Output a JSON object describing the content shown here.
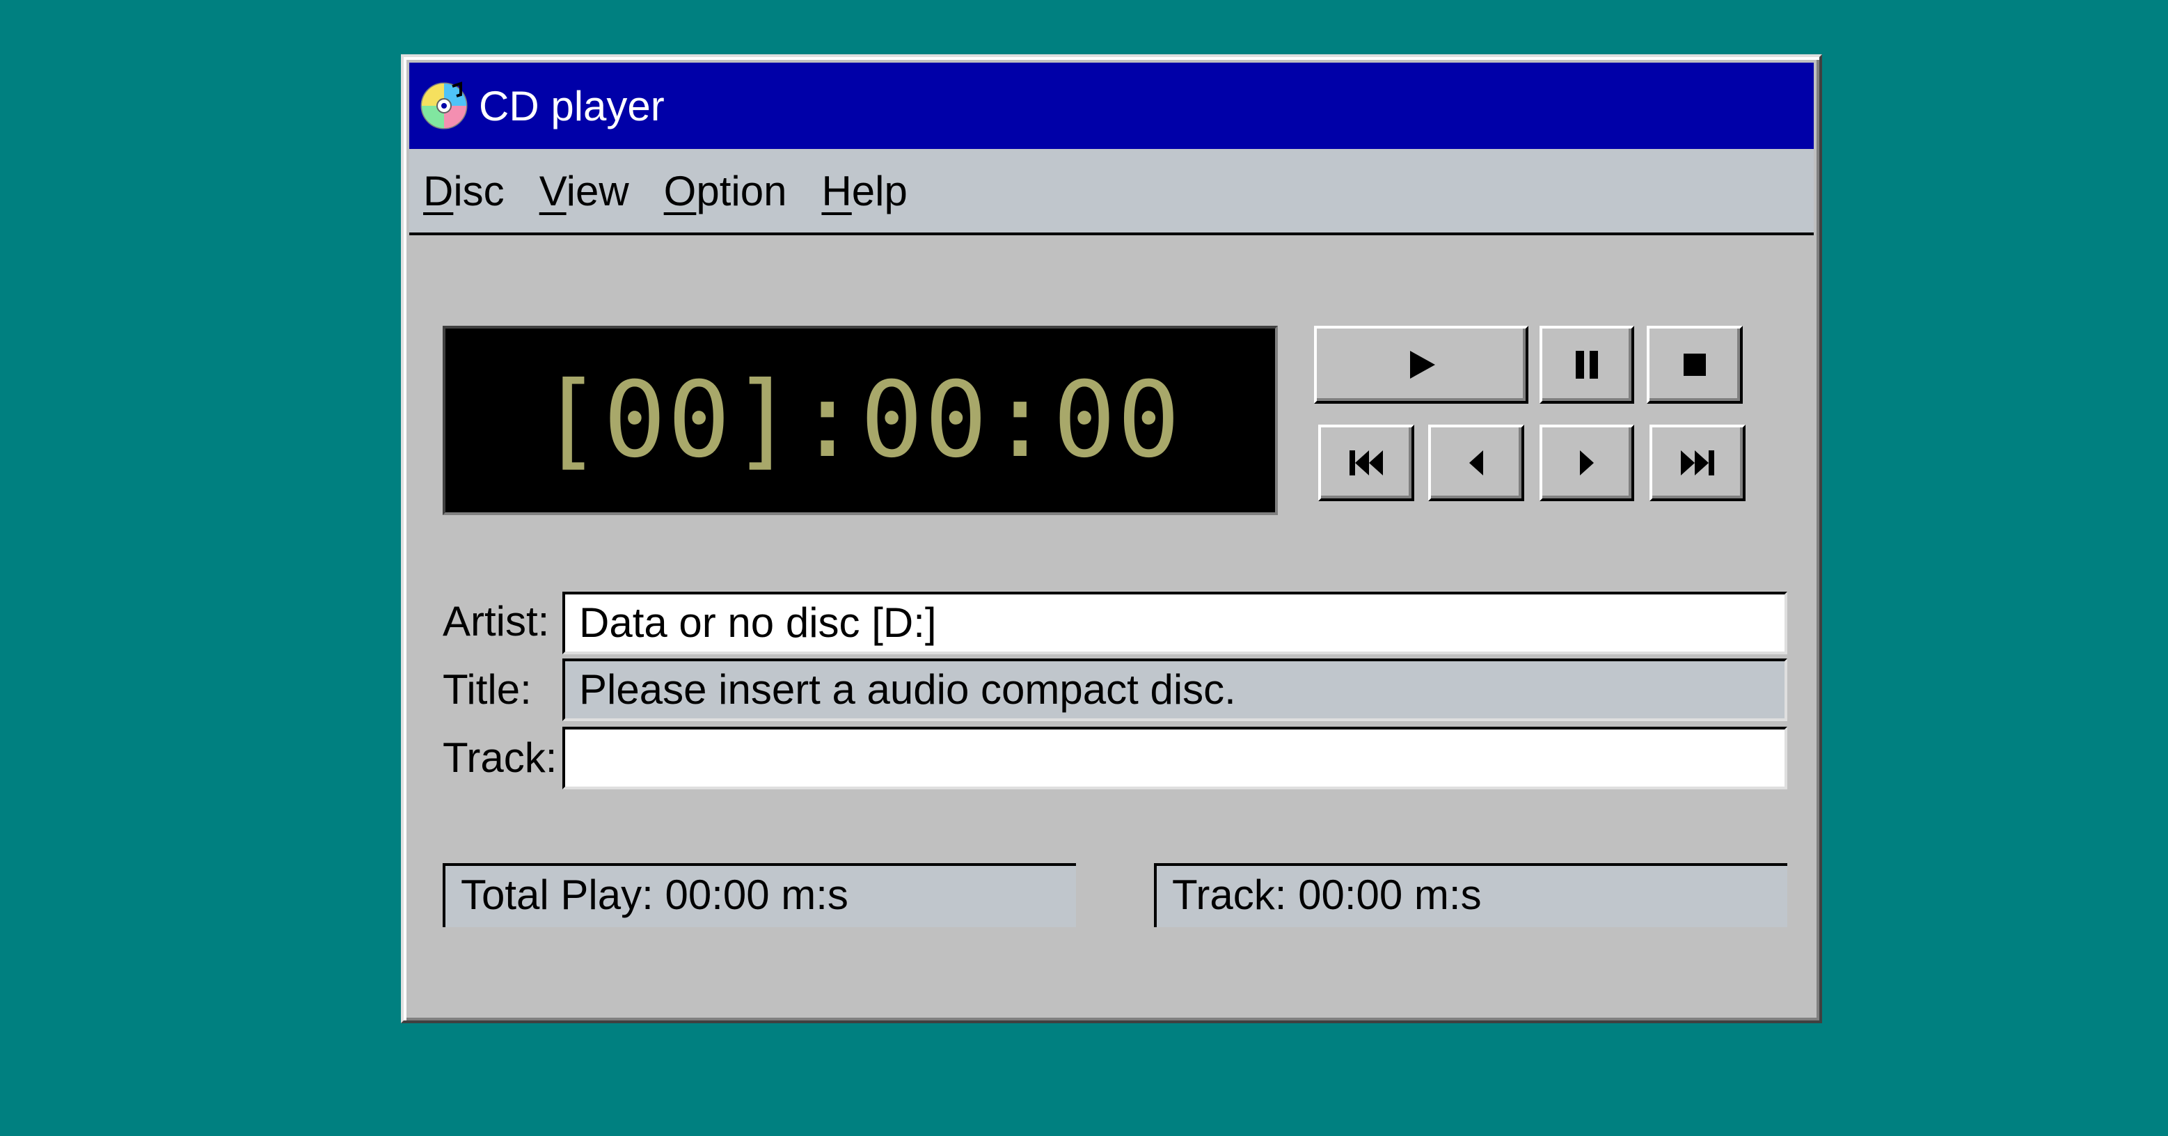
{
  "window": {
    "title": "CD player",
    "icon": "cd-disc-icon"
  },
  "menu": {
    "items": [
      {
        "accel": "D",
        "rest": "isc"
      },
      {
        "accel": "V",
        "rest": "iew"
      },
      {
        "accel": "O",
        "rest": "ption"
      },
      {
        "accel": "H",
        "rest": "elp"
      }
    ]
  },
  "display": {
    "time": "[00]:00:00"
  },
  "controls": {
    "play": "play-icon",
    "pause": "pause-icon",
    "stop": "stop-icon",
    "previous_track": "previous-track-icon",
    "skip_back": "skip-back-icon",
    "skip_forward": "skip-forward-icon",
    "next_track": "next-track-icon"
  },
  "info": {
    "artist_label": "Artist:",
    "artist_value": "Data or no disc [D:]",
    "title_label": "Title:",
    "title_value": "Please insert a audio compact disc.",
    "track_label": "Track:",
    "track_value": ""
  },
  "status": {
    "total_play": "Total Play: 00:00 m:s",
    "track": "Track: 00:00 m:s"
  },
  "colors": {
    "desktop": "#008080",
    "titlebar": "#0000a8",
    "lcd_text": "#a8a86a"
  }
}
